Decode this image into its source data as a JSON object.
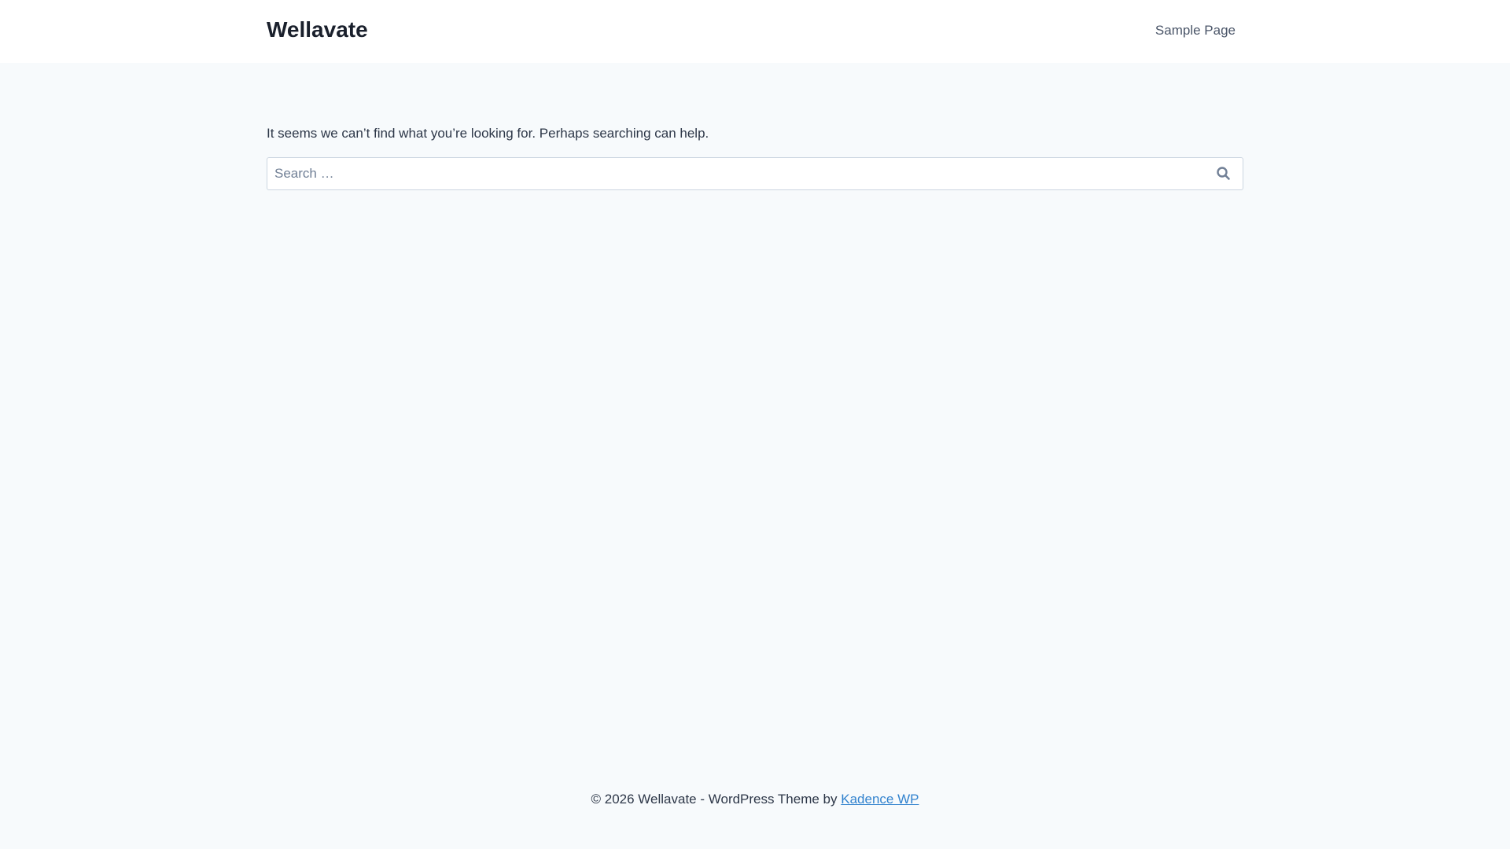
{
  "header": {
    "site_title": "Wellavate",
    "nav": [
      {
        "label": "Sample Page"
      }
    ]
  },
  "main": {
    "message": "It seems we can’t find what you’re looking for. Perhaps searching can help.",
    "search": {
      "placeholder": "Search …",
      "value": "",
      "button_icon": "search-icon"
    }
  },
  "footer": {
    "text": "© 2026 Wellavate - WordPress Theme by ",
    "link": "Kadence WP"
  },
  "colors": {
    "background": "#f7fafc",
    "link": "#3182ce",
    "text": "#2d3748"
  }
}
